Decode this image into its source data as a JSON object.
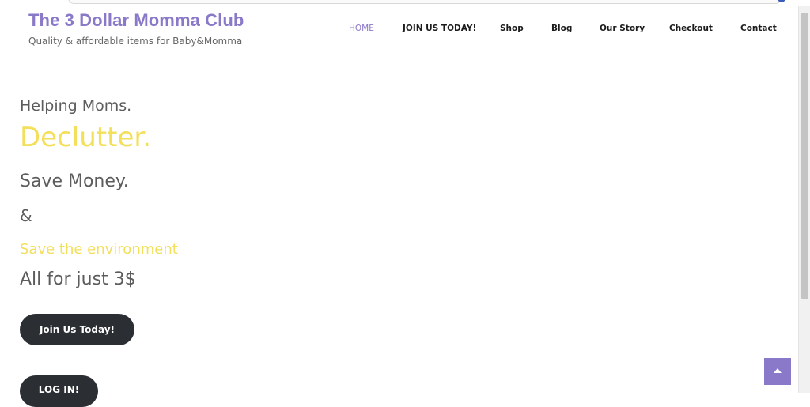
{
  "site": {
    "title": "The 3 Dollar Momma Club",
    "tagline": "Quality & affordable items for Baby&Momma"
  },
  "nav": {
    "items": [
      {
        "label": "HOME",
        "active": true
      },
      {
        "label": "JOIN US TODAY!",
        "active": false
      },
      {
        "label": "Shop",
        "active": false
      },
      {
        "label": "Blog",
        "active": false
      },
      {
        "label": "Our Story",
        "active": false
      },
      {
        "label": "Checkout",
        "active": false
      },
      {
        "label": "Contact",
        "active": false
      }
    ]
  },
  "hero": {
    "line1": "Helping Moms.",
    "line2": "Declutter.",
    "line3": "Save Money.",
    "line4": "&",
    "line5": "Save the environment",
    "line6": "All for just 3$",
    "join_button": "Join Us Today!",
    "login_button": "LOG IN!"
  },
  "colors": {
    "brand_purple": "#8a78c8",
    "accent_yellow": "#f3df5a",
    "button_dark": "#2b2f33"
  },
  "icons": {
    "back_to_top": "chevron-up-icon"
  }
}
